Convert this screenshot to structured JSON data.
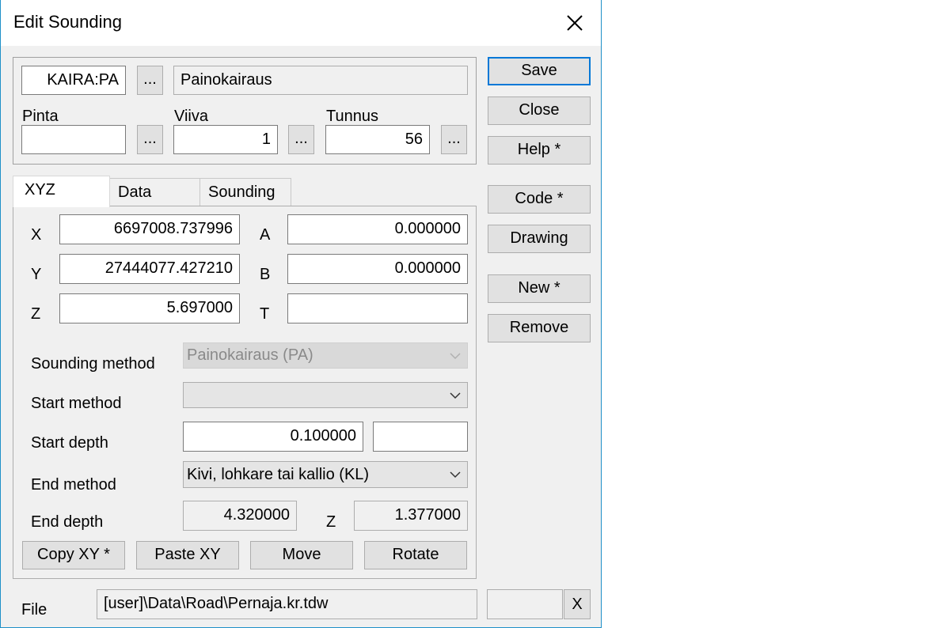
{
  "window": {
    "title": "Edit Sounding"
  },
  "header": {
    "code": "KAIRA:PA",
    "browse": "...",
    "description": "Painokairaus",
    "pinta_label": "Pinta",
    "pinta_value": "",
    "viiva_label": "Viiva",
    "viiva_value": "1",
    "tunnus_label": "Tunnus",
    "tunnus_value": "56"
  },
  "side_buttons": {
    "save": "Save",
    "close": "Close",
    "help": "Help *",
    "code": "Code *",
    "drawing": "Drawing",
    "new": "New *",
    "remove": "Remove"
  },
  "tabs": [
    "XYZ",
    "Data",
    "Sounding"
  ],
  "xyz": {
    "x_label": "X",
    "x_value": "6697008.737996",
    "y_label": "Y",
    "y_value": "27444077.427210",
    "z_label": "Z",
    "z_value": "5.697000",
    "a_label": "A",
    "a_value": "0.000000",
    "b_label": "B",
    "b_value": "0.000000",
    "t_label": "T",
    "t_value": ""
  },
  "sounding": {
    "method_label": "Sounding method",
    "method_value": "Painokairaus (PA)",
    "start_method_label": "Start method",
    "start_method_value": "",
    "start_depth_label": "Start depth",
    "start_depth_value": "0.100000",
    "start_depth_extra": "",
    "end_method_label": "End method",
    "end_method_value": "Kivi, lohkare tai kallio (KL)",
    "end_depth_label": "End depth",
    "end_depth_value": "4.320000",
    "end_z_label": "Z",
    "end_z_value": "1.377000"
  },
  "bottom_buttons": {
    "copy_xy": "Copy XY *",
    "paste_xy": "Paste XY",
    "move": "Move",
    "rotate": "Rotate"
  },
  "file": {
    "label": "File",
    "path": "[user]\\Data\\Road\\Pernaja.kr.tdw",
    "extra": "",
    "clear": "X"
  },
  "icons": {
    "close": "close-icon",
    "dropdown": "chevron-down-icon"
  }
}
